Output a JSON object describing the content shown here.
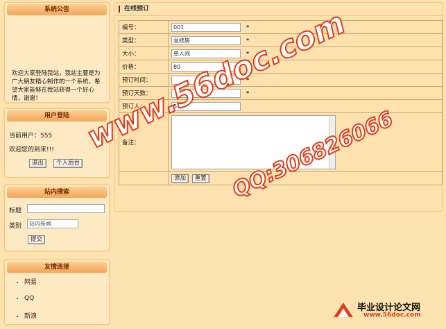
{
  "notice": {
    "title": "系统公告",
    "text": "欢迎大家登陆我站，我站主要是为广大朋友精心制作的一个系统，希望大家能够在我站获得一个好心情，谢谢！"
  },
  "login": {
    "title": "用户登陆",
    "current_user_label": "当前用户：555",
    "welcome": "欢迎您的到来!!!",
    "logout_label": "退出",
    "personal_label": "个人后台"
  },
  "search": {
    "title": "站内搜索",
    "title_label": "标题",
    "type_label": "类别",
    "type_value": "站内新闻",
    "submit_label": "提交"
  },
  "links": {
    "title": "友情连接",
    "items": [
      "网易",
      "QQ",
      "新浪"
    ]
  },
  "booking": {
    "title": "在线预订",
    "fields": {
      "id": {
        "label": "编号：",
        "value": "001"
      },
      "type": {
        "label": "类型：",
        "value": "总统房"
      },
      "size": {
        "label": "大小：",
        "value": "单人间"
      },
      "price": {
        "label": "价格：",
        "value": "80"
      },
      "time": {
        "label": "预订时间：",
        "value": ""
      },
      "days": {
        "label": "预订天数：",
        "value": ""
      },
      "booker": {
        "label": "预订人：",
        "value": "555"
      },
      "remark": {
        "label": "备注：",
        "value": ""
      }
    },
    "required_mark": "*",
    "add_label": "添加",
    "reset_label": "重置"
  },
  "watermark": {
    "site": "www.56doc.com",
    "qq": "QQ:306826066",
    "logo_title": "毕业设计论文网",
    "logo_url": "www.56doc.com"
  },
  "colors": {
    "background": "#fde3b0",
    "header_gradient_top": "#fccf91",
    "header_gradient_bottom": "#f5a55a",
    "watermark_red": "#e23b16"
  }
}
